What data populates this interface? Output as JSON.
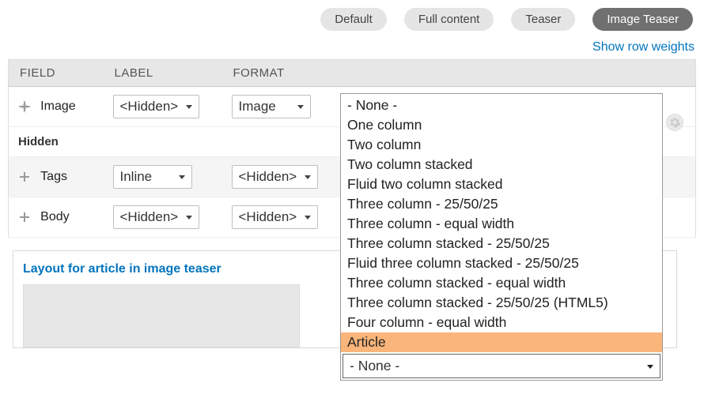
{
  "tabs": {
    "items": [
      {
        "label": "Default",
        "active": false
      },
      {
        "label": "Full content",
        "active": false
      },
      {
        "label": "Teaser",
        "active": false
      },
      {
        "label": "Image Teaser",
        "active": true
      }
    ]
  },
  "links": {
    "show_row_weights": "Show row weights"
  },
  "table": {
    "headers": {
      "field": "FIELD",
      "label": "LABEL",
      "format": "FORMAT"
    },
    "hidden_heading": "Hidden",
    "rows": [
      {
        "name": "Image",
        "label_select": "<Hidden>",
        "format_select": "Image",
        "section": "visible"
      },
      {
        "name": "Tags",
        "label_select": "Inline",
        "format_select": "<Hidden>",
        "section": "hidden"
      },
      {
        "name": "Body",
        "label_select": "<Hidden>",
        "format_select": "<Hidden>",
        "section": "hidden"
      }
    ]
  },
  "details": {
    "summary": "Layout for article in image teaser"
  },
  "layout_listbox": {
    "options": [
      "- None -",
      "One column",
      "Two column",
      "Two column stacked",
      "Fluid two column stacked",
      "Three column - 25/50/25",
      "Three column - equal width",
      "Three column stacked - 25/50/25",
      "Fluid three column stacked - 25/50/25",
      "Three column stacked - equal width",
      "Three column stacked - 25/50/25 (HTML5)",
      "Four column - equal width",
      "Article"
    ],
    "highlighted": "Article",
    "current_value": "- None -"
  }
}
